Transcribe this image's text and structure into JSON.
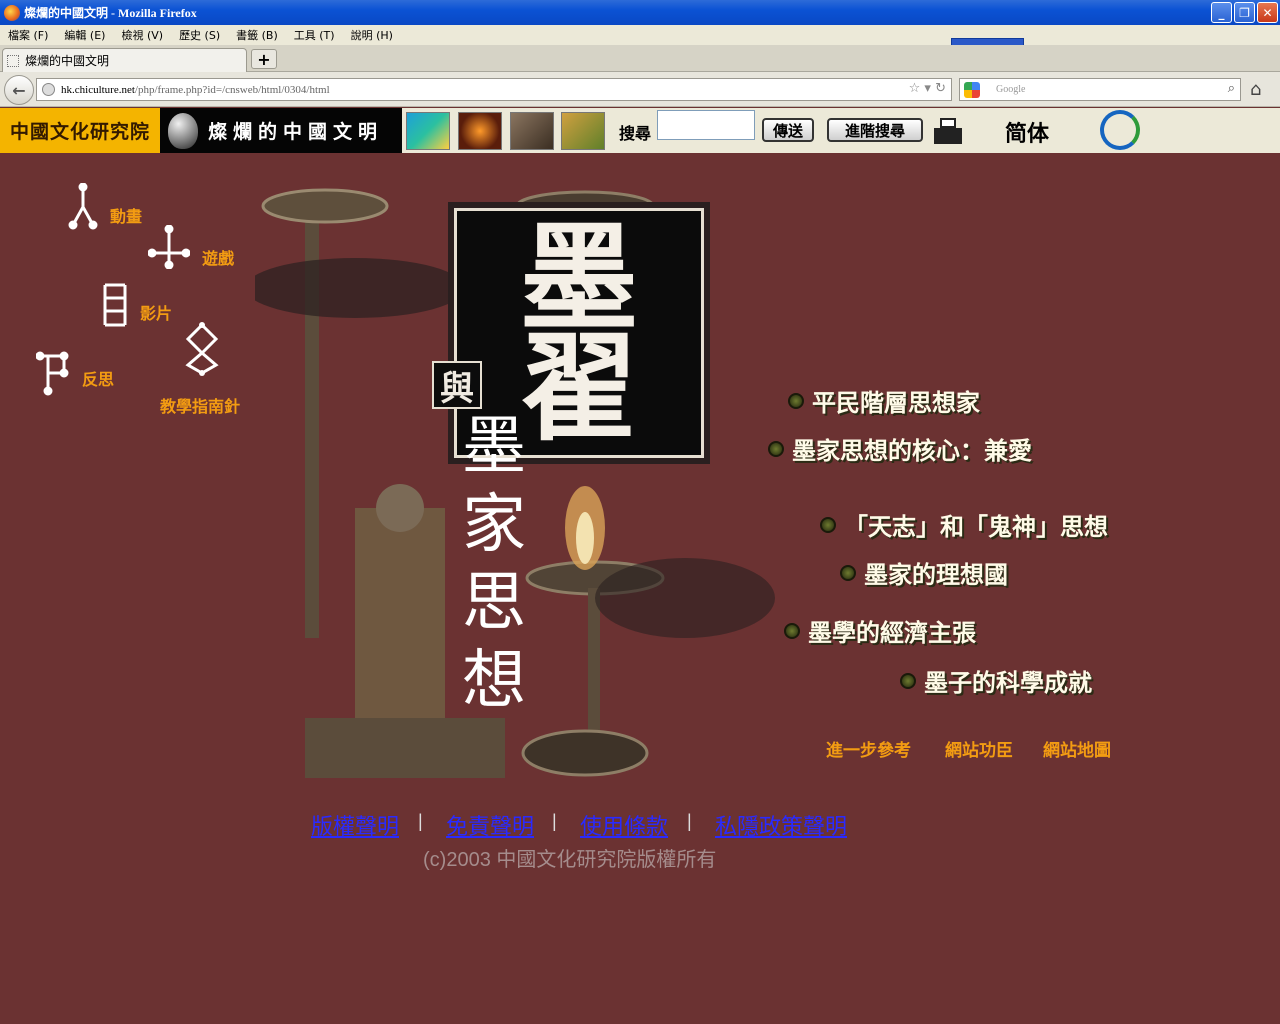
{
  "window": {
    "title": "燦爛的中國文明 - Mozilla Firefox"
  },
  "menu": [
    "檔案 (F)",
    "編輯 (E)",
    "檢視 (V)",
    "歷史 (S)",
    "書籤 (B)",
    "工具 (T)",
    "說明 (H)"
  ],
  "tab": {
    "label": "燦爛的中國文明"
  },
  "address": {
    "host": "hk.chiculture.net",
    "path": "/php/frame.php?id=/cnsweb/html/0304/html"
  },
  "search": {
    "placeholder": "Google"
  },
  "header": {
    "logo": "中國文化研究院",
    "brand": "燦爛的中國文明",
    "search_label": "搜尋",
    "send_button": "傳送",
    "advanced_button": "進階搜尋",
    "simplified": "简体"
  },
  "nav": {
    "animation": "動畫",
    "game": "遊戲",
    "video": "影片",
    "reflection": "反思",
    "guide": "教學指南針"
  },
  "title": {
    "main_1": "墨",
    "main_2": "翟",
    "connector": "與",
    "sub": [
      "墨",
      "家",
      "思",
      "想"
    ]
  },
  "topics": [
    "平民階層思想家",
    "墨家思想的核心：兼愛",
    "「天志」和「鬼神」思想",
    "墨家的理想國",
    "墨學的經濟主張",
    "墨子的科學成就"
  ],
  "sub_links": {
    "reference": "進一步參考",
    "credits": "網站功臣",
    "sitemap": "網站地圖"
  },
  "footer": {
    "copyright_stmt": "版權聲明",
    "disclaimer": "免責聲明",
    "terms": "使用條款",
    "privacy": "私隱政策聲明",
    "copyright": "(c)2003 中國文化研究院版權所有"
  },
  "colors": {
    "background": "#6b3232",
    "link_orange": "#f39c12",
    "footer_link": "#2a2aff"
  }
}
